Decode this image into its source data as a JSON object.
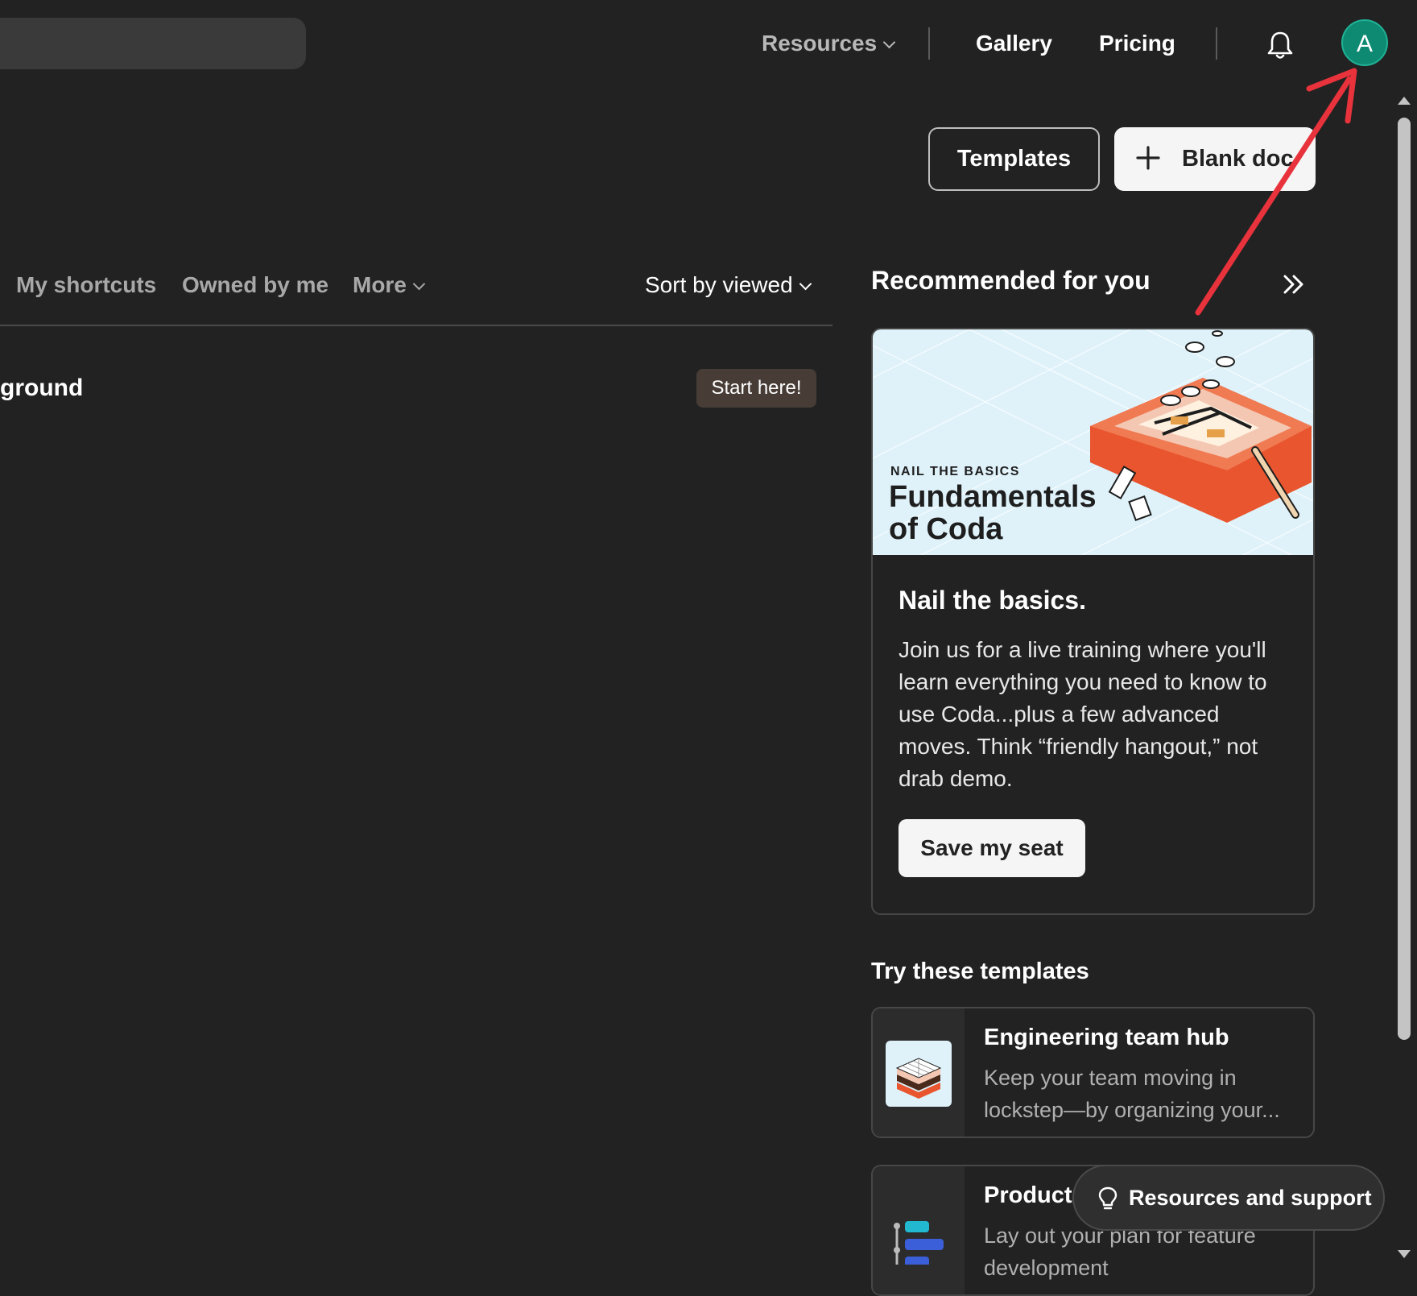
{
  "topbar": {
    "resources_label": "Resources",
    "gallery_label": "Gallery",
    "pricing_label": "Pricing",
    "avatar_initial": "A"
  },
  "actions": {
    "templates_label": "Templates",
    "blank_doc_label": "Blank doc"
  },
  "tabs": {
    "items": [
      "My shortcuts",
      "Owned by me",
      "More"
    ],
    "sort_label": "Sort by viewed"
  },
  "doc_row": {
    "title": "ground",
    "badge": "Start here!"
  },
  "recommended": {
    "title": "Recommended for you",
    "card": {
      "image_eyebrow": "NAIL THE BASICS",
      "image_title_line1": "Fundamentals",
      "image_title_line2": "of Coda",
      "heading": "Nail the basics.",
      "body": "Join us for a live training where you'll learn everything you need to know to use Coda...plus a few advanced moves. Think “friendly hangout,” not drab demo.",
      "button_label": "Save my seat"
    }
  },
  "templates": {
    "title": "Try these templates",
    "items": [
      {
        "title": "Engineering team hub",
        "description": "Keep your team moving in lockstep—by organizing your..."
      },
      {
        "title": "Product",
        "description": "Lay out your plan for feature development"
      }
    ]
  },
  "support": {
    "label": "Resources and support"
  },
  "colors": {
    "background": "#222222",
    "avatar": "#0e8a72",
    "annotation_arrow": "#e8323c",
    "badge_bg": "#473d36"
  }
}
